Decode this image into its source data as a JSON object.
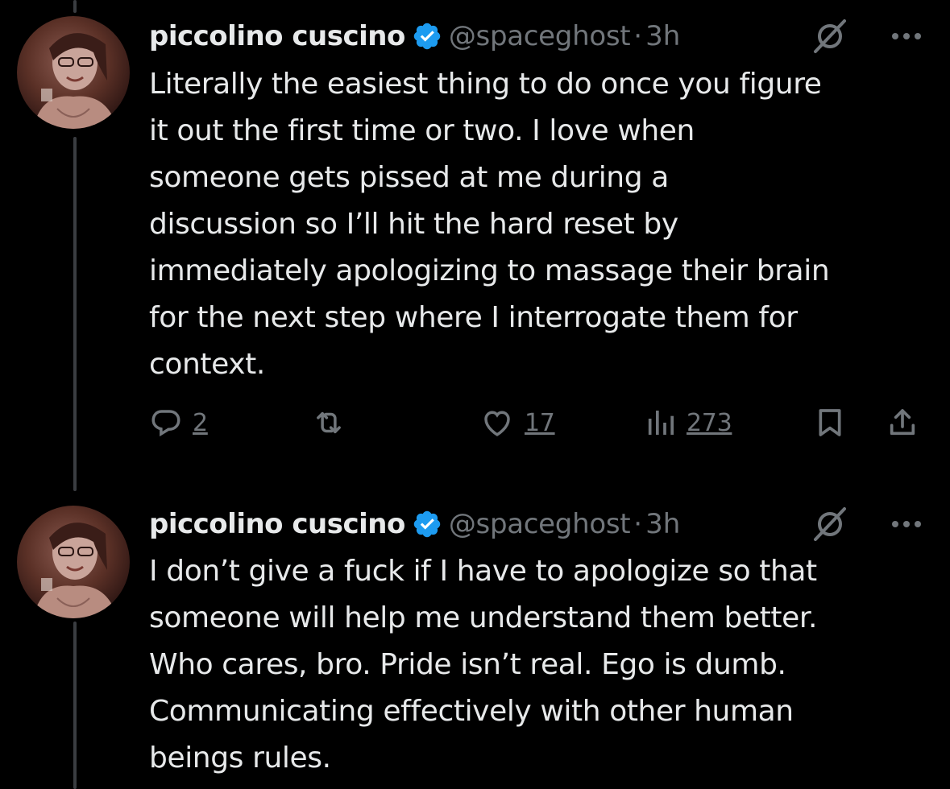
{
  "colors": {
    "background": "#000000",
    "text_primary": "#e7e9ea",
    "text_secondary": "#71767b",
    "verified_badge": "#1d9bf0",
    "thread_line": "#3a3d41"
  },
  "tweets": [
    {
      "display_name": "piccolino cuscino",
      "handle": "@spaceghost",
      "separator": "·",
      "time": "3h",
      "verified_icon": "verified-badge-icon",
      "body_lines": [
        "Literally the easiest thing to do once you figure",
        "it out the first time or two. I love when",
        "someone gets pissed at me during a",
        "discussion so I’ll hit the hard reset by",
        "immediately apologizing to massage their brain",
        "for the next step where I interrogate them for",
        "context."
      ],
      "actions": {
        "reply_count": "2",
        "retweet_count": "",
        "like_count": "17",
        "view_count": "273"
      }
    },
    {
      "display_name": "piccolino cuscino",
      "handle": "@spaceghost",
      "separator": "·",
      "time": "3h",
      "verified_icon": "verified-badge-icon",
      "body_lines": [
        "I don’t give a fuck if I have to apologize so that",
        "someone will help me understand them better.",
        "Who cares, bro. Pride isn’t real. Ego is dumb.",
        "Communicating effectively with other human",
        "beings rules."
      ]
    }
  ]
}
